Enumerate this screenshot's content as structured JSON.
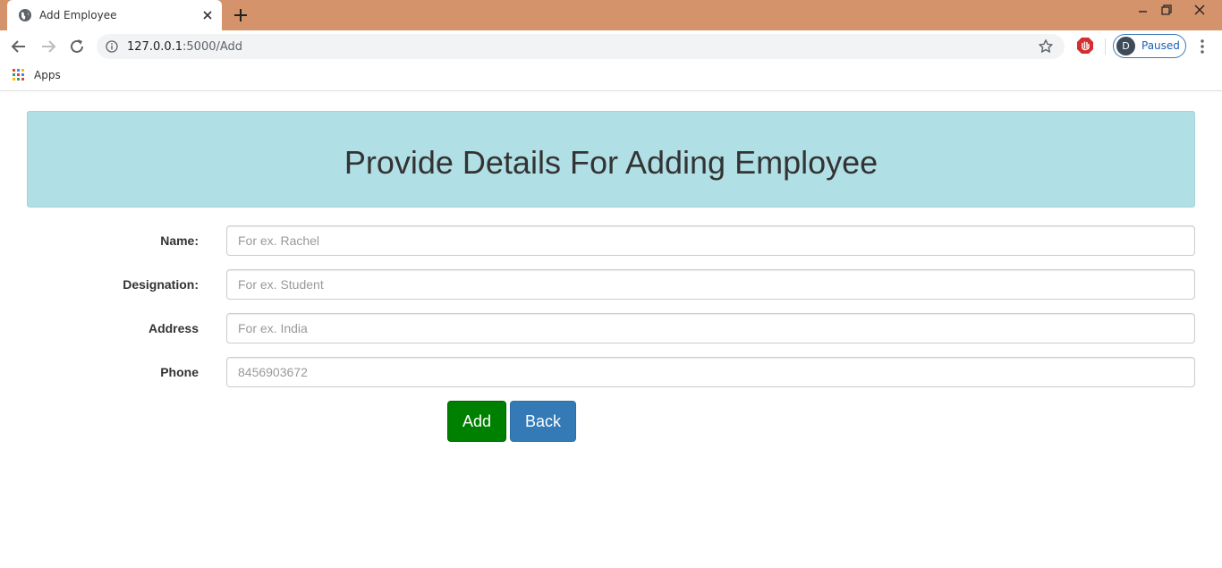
{
  "browser": {
    "tab_title": "Add Employee",
    "url_host": "127.0.0.1",
    "url_path": ":5000/Add",
    "profile_initial": "D",
    "profile_status": "Paused",
    "bookmarks": [
      {
        "label": "Apps"
      }
    ],
    "titlebar_color": "#d4936b"
  },
  "page": {
    "heading": "Provide Details For Adding Employee",
    "heading_bg": "#b0dfe5",
    "fields": [
      {
        "label": "Name:",
        "placeholder": "For ex. Rachel",
        "value": ""
      },
      {
        "label": "Designation:",
        "placeholder": "For ex. Student",
        "value": ""
      },
      {
        "label": "Address",
        "placeholder": "For ex. India",
        "value": ""
      },
      {
        "label": "Phone",
        "placeholder": "8456903672",
        "value": ""
      }
    ],
    "buttons": {
      "add_label": "Add",
      "back_label": "Back",
      "add_color": "#008000",
      "back_color": "#337ab7"
    }
  }
}
